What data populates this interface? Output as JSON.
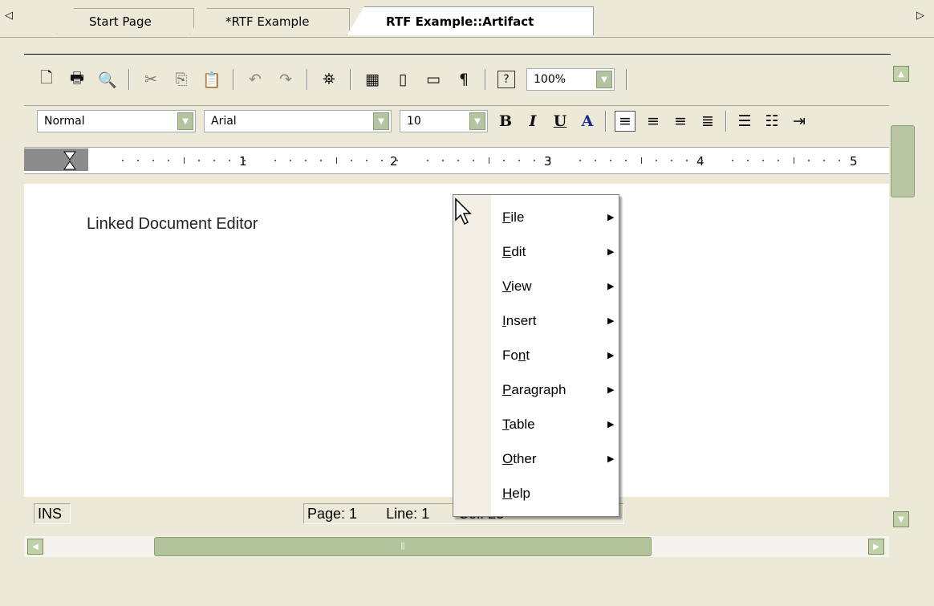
{
  "tabs": {
    "left_arrow": "◁",
    "right_arrow": "▷",
    "items": [
      {
        "label": "Start Page"
      },
      {
        "label": "*RTF Example"
      },
      {
        "label": "RTF Example::Artifact"
      }
    ],
    "active": 2
  },
  "toolbar1": {
    "zoom_value": "100%"
  },
  "toolbar2": {
    "style_value": "Normal",
    "font_value": "Arial",
    "size_value": "10",
    "bold_label": "B",
    "italic_label": "I",
    "underline_label": "U",
    "color_label": "A"
  },
  "ruler": {
    "labels": [
      "1",
      "2",
      "3",
      "4",
      "5"
    ]
  },
  "document": {
    "text": "Linked Document Editor"
  },
  "status": {
    "mode": "INS",
    "page": "Page: 1",
    "line": "Line: 1",
    "col": "Col: 23"
  },
  "context_menu": {
    "items": [
      {
        "pre": "",
        "u": "F",
        "post": "ile",
        "submenu": true
      },
      {
        "pre": "",
        "u": "E",
        "post": "dit",
        "submenu": true
      },
      {
        "pre": "",
        "u": "V",
        "post": "iew",
        "submenu": true
      },
      {
        "pre": "",
        "u": "I",
        "post": "nsert",
        "submenu": true
      },
      {
        "pre": "Fo",
        "u": "n",
        "post": "t",
        "submenu": true
      },
      {
        "pre": "",
        "u": "P",
        "post": "aragraph",
        "submenu": true
      },
      {
        "pre": "",
        "u": "T",
        "post": "able",
        "submenu": true
      },
      {
        "pre": "",
        "u": "O",
        "post": "ther",
        "submenu": true
      },
      {
        "pre": "",
        "u": "H",
        "post": "elp",
        "submenu": false
      }
    ]
  },
  "icons": {
    "new": "new-document-icon",
    "print": "print-icon",
    "preview": "print-preview-icon",
    "cut": "cut-icon",
    "copy": "copy-icon",
    "paste": "paste-icon",
    "undo": "undo-icon",
    "redo": "redo-icon",
    "find": "find-icon",
    "accent_green": "#b5c4a0"
  }
}
